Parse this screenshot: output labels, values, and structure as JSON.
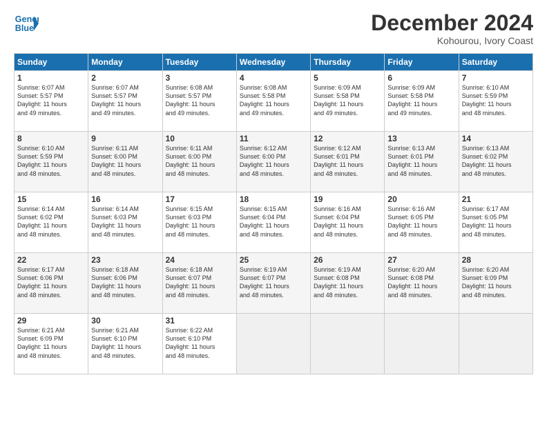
{
  "logo": {
    "line1": "General",
    "line2": "Blue"
  },
  "header": {
    "title": "December 2024",
    "subtitle": "Kohourou, Ivory Coast"
  },
  "weekdays": [
    "Sunday",
    "Monday",
    "Tuesday",
    "Wednesday",
    "Thursday",
    "Friday",
    "Saturday"
  ],
  "weeks": [
    [
      {
        "day": "1",
        "info": "Sunrise: 6:07 AM\nSunset: 5:57 PM\nDaylight: 11 hours\nand 49 minutes."
      },
      {
        "day": "2",
        "info": "Sunrise: 6:07 AM\nSunset: 5:57 PM\nDaylight: 11 hours\nand 49 minutes."
      },
      {
        "day": "3",
        "info": "Sunrise: 6:08 AM\nSunset: 5:57 PM\nDaylight: 11 hours\nand 49 minutes."
      },
      {
        "day": "4",
        "info": "Sunrise: 6:08 AM\nSunset: 5:58 PM\nDaylight: 11 hours\nand 49 minutes."
      },
      {
        "day": "5",
        "info": "Sunrise: 6:09 AM\nSunset: 5:58 PM\nDaylight: 11 hours\nand 49 minutes."
      },
      {
        "day": "6",
        "info": "Sunrise: 6:09 AM\nSunset: 5:58 PM\nDaylight: 11 hours\nand 49 minutes."
      },
      {
        "day": "7",
        "info": "Sunrise: 6:10 AM\nSunset: 5:59 PM\nDaylight: 11 hours\nand 48 minutes."
      }
    ],
    [
      {
        "day": "8",
        "info": "Sunrise: 6:10 AM\nSunset: 5:59 PM\nDaylight: 11 hours\nand 48 minutes."
      },
      {
        "day": "9",
        "info": "Sunrise: 6:11 AM\nSunset: 6:00 PM\nDaylight: 11 hours\nand 48 minutes."
      },
      {
        "day": "10",
        "info": "Sunrise: 6:11 AM\nSunset: 6:00 PM\nDaylight: 11 hours\nand 48 minutes."
      },
      {
        "day": "11",
        "info": "Sunrise: 6:12 AM\nSunset: 6:00 PM\nDaylight: 11 hours\nand 48 minutes."
      },
      {
        "day": "12",
        "info": "Sunrise: 6:12 AM\nSunset: 6:01 PM\nDaylight: 11 hours\nand 48 minutes."
      },
      {
        "day": "13",
        "info": "Sunrise: 6:13 AM\nSunset: 6:01 PM\nDaylight: 11 hours\nand 48 minutes."
      },
      {
        "day": "14",
        "info": "Sunrise: 6:13 AM\nSunset: 6:02 PM\nDaylight: 11 hours\nand 48 minutes."
      }
    ],
    [
      {
        "day": "15",
        "info": "Sunrise: 6:14 AM\nSunset: 6:02 PM\nDaylight: 11 hours\nand 48 minutes."
      },
      {
        "day": "16",
        "info": "Sunrise: 6:14 AM\nSunset: 6:03 PM\nDaylight: 11 hours\nand 48 minutes."
      },
      {
        "day": "17",
        "info": "Sunrise: 6:15 AM\nSunset: 6:03 PM\nDaylight: 11 hours\nand 48 minutes."
      },
      {
        "day": "18",
        "info": "Sunrise: 6:15 AM\nSunset: 6:04 PM\nDaylight: 11 hours\nand 48 minutes."
      },
      {
        "day": "19",
        "info": "Sunrise: 6:16 AM\nSunset: 6:04 PM\nDaylight: 11 hours\nand 48 minutes."
      },
      {
        "day": "20",
        "info": "Sunrise: 6:16 AM\nSunset: 6:05 PM\nDaylight: 11 hours\nand 48 minutes."
      },
      {
        "day": "21",
        "info": "Sunrise: 6:17 AM\nSunset: 6:05 PM\nDaylight: 11 hours\nand 48 minutes."
      }
    ],
    [
      {
        "day": "22",
        "info": "Sunrise: 6:17 AM\nSunset: 6:06 PM\nDaylight: 11 hours\nand 48 minutes."
      },
      {
        "day": "23",
        "info": "Sunrise: 6:18 AM\nSunset: 6:06 PM\nDaylight: 11 hours\nand 48 minutes."
      },
      {
        "day": "24",
        "info": "Sunrise: 6:18 AM\nSunset: 6:07 PM\nDaylight: 11 hours\nand 48 minutes."
      },
      {
        "day": "25",
        "info": "Sunrise: 6:19 AM\nSunset: 6:07 PM\nDaylight: 11 hours\nand 48 minutes."
      },
      {
        "day": "26",
        "info": "Sunrise: 6:19 AM\nSunset: 6:08 PM\nDaylight: 11 hours\nand 48 minutes."
      },
      {
        "day": "27",
        "info": "Sunrise: 6:20 AM\nSunset: 6:08 PM\nDaylight: 11 hours\nand 48 minutes."
      },
      {
        "day": "28",
        "info": "Sunrise: 6:20 AM\nSunset: 6:09 PM\nDaylight: 11 hours\nand 48 minutes."
      }
    ],
    [
      {
        "day": "29",
        "info": "Sunrise: 6:21 AM\nSunset: 6:09 PM\nDaylight: 11 hours\nand 48 minutes."
      },
      {
        "day": "30",
        "info": "Sunrise: 6:21 AM\nSunset: 6:10 PM\nDaylight: 11 hours\nand 48 minutes."
      },
      {
        "day": "31",
        "info": "Sunrise: 6:22 AM\nSunset: 6:10 PM\nDaylight: 11 hours\nand 48 minutes."
      },
      {
        "day": "",
        "info": ""
      },
      {
        "day": "",
        "info": ""
      },
      {
        "day": "",
        "info": ""
      },
      {
        "day": "",
        "info": ""
      }
    ]
  ]
}
